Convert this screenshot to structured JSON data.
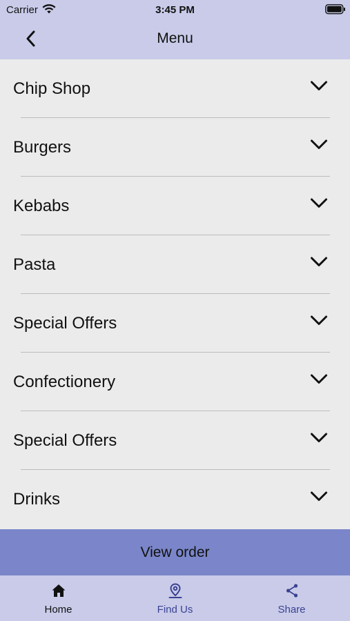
{
  "status_bar": {
    "carrier": "Carrier",
    "time": "3:45 PM"
  },
  "nav": {
    "title": "Menu",
    "back_icon": "chevron-left-icon"
  },
  "menu": {
    "items": [
      {
        "label": "Chip Shop"
      },
      {
        "label": "Burgers"
      },
      {
        "label": "Kebabs"
      },
      {
        "label": "Pasta"
      },
      {
        "label": "Special Offers"
      },
      {
        "label": "Confectionery"
      },
      {
        "label": "Special Offers"
      },
      {
        "label": "Drinks"
      }
    ],
    "expand_icon": "chevron-down-icon"
  },
  "order": {
    "button_label": "View order"
  },
  "tabbar": {
    "tabs": [
      {
        "label": "Home",
        "icon": "home-icon",
        "active": true
      },
      {
        "label": "Find Us",
        "icon": "location-pin-icon",
        "active": false
      },
      {
        "label": "Share",
        "icon": "share-icon",
        "active": false
      }
    ]
  },
  "colors": {
    "header_bg": "#c9cbe9",
    "list_bg": "#ebebeb",
    "order_button_bg": "#7a86c9",
    "tab_inactive": "#3a4290"
  }
}
